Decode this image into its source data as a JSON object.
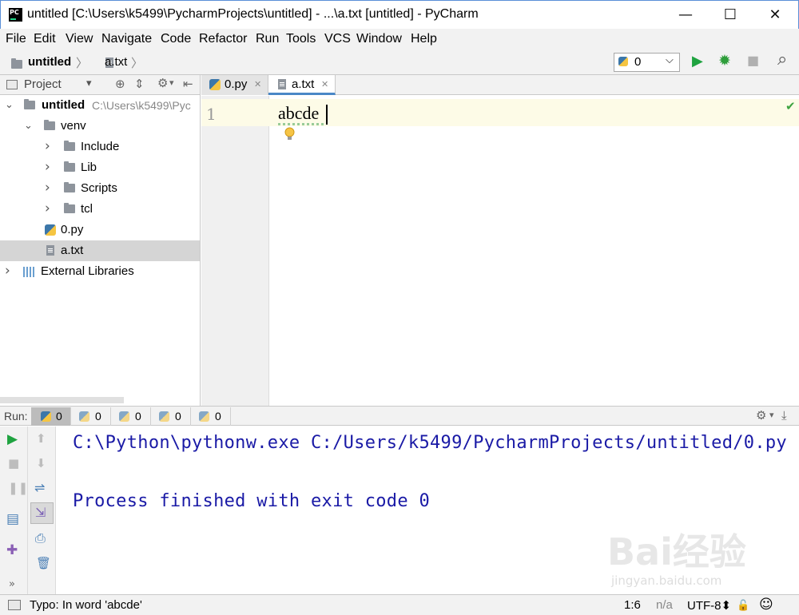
{
  "window": {
    "logo_text": "PC",
    "title": "untitled [C:\\Users\\k5499\\PycharmProjects\\untitled] - ...\\a.txt [untitled] - PyCharm",
    "minimize": "—",
    "maximize": "☐",
    "close": "✕"
  },
  "menu": [
    "File",
    "Edit",
    "View",
    "Navigate",
    "Code",
    "Refactor",
    "Run",
    "Tools",
    "VCS",
    "Window",
    "Help"
  ],
  "breadcrumb": {
    "project": "untitled",
    "file": "a.txt",
    "sep": "〉"
  },
  "run_config": {
    "value": "0",
    "arrow": "⌵"
  },
  "toolbar_icons": {
    "run": "▶",
    "debug": "✹",
    "stop": "■",
    "search": "⌕"
  },
  "project_panel": {
    "title": "Project",
    "dropdown": "▾",
    "tree": [
      {
        "label": "untitled",
        "path": "C:\\Users\\k5499\\Pyc",
        "chevron": "⌄",
        "icon": "folder-icon",
        "bold": true
      },
      {
        "label": "venv",
        "chevron": "⌄",
        "icon": "folder-icon"
      },
      {
        "label": "Include",
        "chevron": "›",
        "icon": "folder-icon"
      },
      {
        "label": "Lib",
        "chevron": "›",
        "icon": "folder-icon"
      },
      {
        "label": "Scripts",
        "chevron": "›",
        "icon": "folder-icon"
      },
      {
        "label": "tcl",
        "chevron": "›",
        "icon": "folder-icon"
      },
      {
        "label": "0.py",
        "icon": "python-file-icon"
      },
      {
        "label": "a.txt",
        "icon": "text-file-icon",
        "selected": true
      },
      {
        "label": "External Libraries",
        "chevron": "›",
        "icon": "library-icon"
      }
    ]
  },
  "editor": {
    "tabs": [
      {
        "label": "0.py",
        "close": "✕",
        "active": false
      },
      {
        "label": "a.txt",
        "close": "✕",
        "active": true
      }
    ],
    "line_number": "1",
    "code": "abcde",
    "check": "✔"
  },
  "run_panel": {
    "label": "Run:",
    "tabs": [
      "0",
      "0",
      "0",
      "0",
      "0"
    ],
    "console": [
      "C:\\Python\\pythonw.exe C:/Users/k5499/PycharmProjects/untitled/0.py",
      "",
      "Process finished with exit code 0"
    ]
  },
  "status": {
    "message": "Typo: In word 'abcde'",
    "position": "1:6",
    "line_sep": "n/a",
    "encoding": "UTF-8⬍",
    "lock": "🔓",
    "inspector": "☺"
  },
  "watermark": {
    "main": "Bai经验",
    "sub": "jingyan.baidu.com"
  },
  "colors": {
    "accent": "#4a88c7",
    "console_text": "#1a1aa6",
    "run_green": "#1fa340",
    "current_line": "#fdfbe7"
  }
}
